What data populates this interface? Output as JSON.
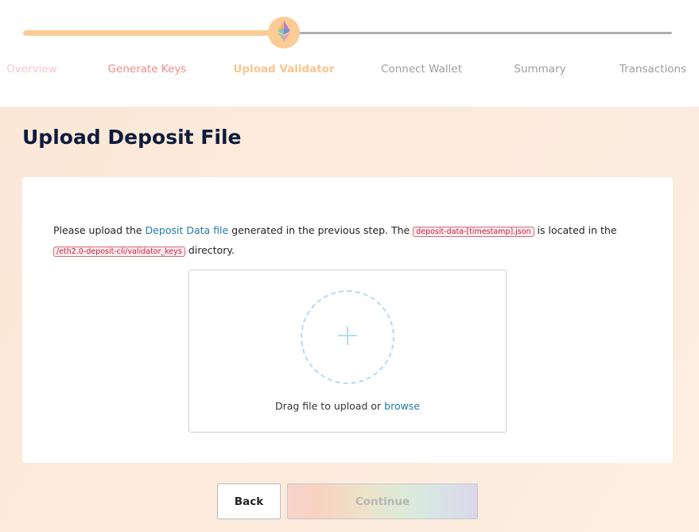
{
  "steps": [
    {
      "label": "Overview",
      "state": "done"
    },
    {
      "label": "Generate Keys",
      "state": "done"
    },
    {
      "label": "Upload Validator",
      "state": "current"
    },
    {
      "label": "Connect Wallet",
      "state": "todo"
    },
    {
      "label": "Summary",
      "state": "todo"
    },
    {
      "label": "Transactions",
      "state": "todo"
    }
  ],
  "progress_icon": "ethereum-diamond-icon",
  "colors": {
    "accent": "#fccb96",
    "title": "#0f1b3d",
    "link": "#1d7ba5",
    "code": "#c7253e",
    "dashed_circle": "#b4dcf0"
  },
  "page": {
    "title": "Upload Deposit File"
  },
  "instructions": {
    "part1": "Please upload the ",
    "link": "Deposit Data file",
    "part2": " generated in the previous step. The ",
    "code_file": "deposit-data-[timestamp].json",
    "part3": " is located in the ",
    "code_dir": "/eth2.0-deposit-cli/validator_keys",
    "part4": " directory."
  },
  "dropzone": {
    "icon": "plus-icon",
    "text": "Drag file to upload or ",
    "browse": "browse"
  },
  "buttons": {
    "back": "Back",
    "continue": "Continue"
  }
}
